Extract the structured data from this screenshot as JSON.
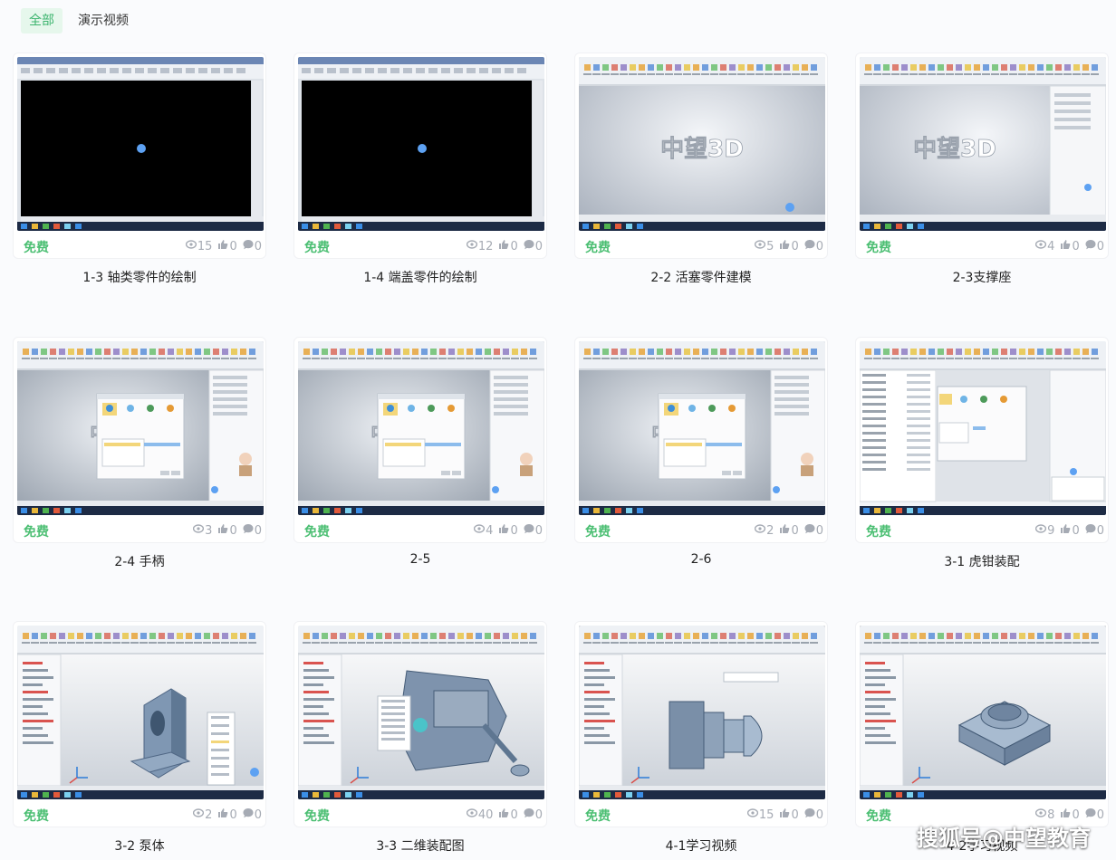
{
  "tabs": [
    {
      "label": "全部",
      "active": true
    },
    {
      "label": "演示视频",
      "active": false
    }
  ],
  "cards": [
    {
      "title": "1-3 轴类零件的绘制",
      "price": "免费",
      "views": "15",
      "likes": "0",
      "comments": "0",
      "thumb": "dark"
    },
    {
      "title": "1-4 端盖零件的绘制",
      "price": "免费",
      "views": "12",
      "likes": "0",
      "comments": "0",
      "thumb": "dark"
    },
    {
      "title": "2-2 活塞零件建模",
      "price": "免费",
      "views": "5",
      "likes": "0",
      "comments": "0",
      "thumb": "logo",
      "logo": "中望3D"
    },
    {
      "title": "2-3支撑座",
      "price": "免费",
      "views": "4",
      "likes": "0",
      "comments": "0",
      "thumb": "logo-panel",
      "logo": "中望3D"
    },
    {
      "title": "2-4 手柄",
      "price": "免费",
      "views": "3",
      "likes": "0",
      "comments": "0",
      "thumb": "dialog"
    },
    {
      "title": "2-5",
      "price": "免费",
      "views": "4",
      "likes": "0",
      "comments": "0",
      "thumb": "dialog"
    },
    {
      "title": "2-6",
      "price": "免费",
      "views": "2",
      "likes": "0",
      "comments": "0",
      "thumb": "dialog"
    },
    {
      "title": "3-1 虎钳装配",
      "price": "免费",
      "views": "9",
      "likes": "0",
      "comments": "0",
      "thumb": "table"
    },
    {
      "title": "3-2 泵体",
      "price": "免费",
      "views": "2",
      "likes": "0",
      "comments": "0",
      "thumb": "part-bracket"
    },
    {
      "title": "3-3 二维装配图",
      "price": "免费",
      "views": "40",
      "likes": "0",
      "comments": "0",
      "thumb": "part-vise"
    },
    {
      "title": "4-1学习视频",
      "price": "免费",
      "views": "15",
      "likes": "0",
      "comments": "0",
      "thumb": "part-shaft"
    },
    {
      "title": "4-2学习视频",
      "price": "免费",
      "views": "8",
      "likes": "0",
      "comments": "0",
      "thumb": "part-block"
    }
  ],
  "watermark": "搜狐号@中望教育",
  "colors": {
    "accent": "#4cbf73",
    "tab_active_bg": "#e6f7ec",
    "meta": "#a6abb4"
  }
}
